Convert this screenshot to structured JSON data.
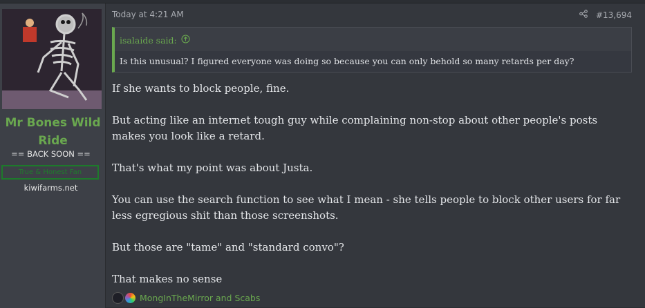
{
  "user": {
    "name": "Mr Bones Wild Ride",
    "title": "== BACK SOON ==",
    "banner": "True & Honest Fan",
    "site": "kiwifarms.net"
  },
  "post": {
    "time": "Today at 4:21 AM",
    "number": "#13,694",
    "quote": {
      "author": "isalaide said:",
      "text": "Is this unusual? I figured everyone was doing so because you can only behold so many retards per day?"
    },
    "paragraphs": [
      "If she wants to block people, fine.",
      "But acting like an internet tough guy while complaining non-stop about other people's posts makes you look like a retard.",
      "That's what my point was about Justa.",
      "You can use the search function to see what I mean - she tells people to block other users for far less egregious shit than those screenshots.",
      "But those are \"tame\" and \"standard convo\"?",
      "That makes no sense"
    ],
    "reactions_text": "MongInTheMirror and Scabs"
  },
  "colors": {
    "accent": "#6aa84f",
    "banner": "#1d7a2b"
  }
}
